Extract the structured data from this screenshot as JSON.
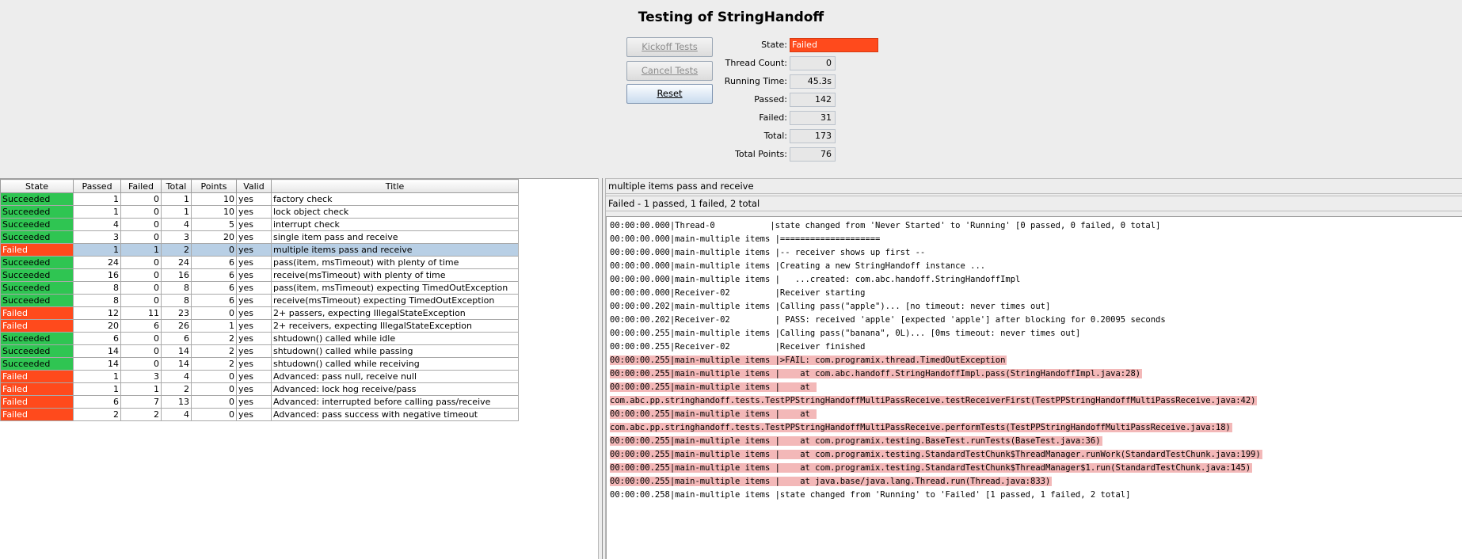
{
  "window_title": "Testing of StringHandoff",
  "buttons": {
    "kickoff": "Kickoff Tests",
    "cancel": "Cancel Tests",
    "reset": "Reset"
  },
  "stats": [
    {
      "label": "State:",
      "value": "Failed",
      "kind": "state"
    },
    {
      "label": "Thread Count:",
      "value": "0"
    },
    {
      "label": "Running Time:",
      "value": "45.3s"
    },
    {
      "label": "Passed:",
      "value": "142"
    },
    {
      "label": "Failed:",
      "value": "31"
    },
    {
      "label": "Total:",
      "value": "173"
    },
    {
      "label": "Total Points:",
      "value": "76"
    }
  ],
  "table": {
    "columns": [
      "State",
      "Passed",
      "Failed",
      "Total",
      "Points",
      "Valid",
      "Title"
    ],
    "rows": [
      [
        "Succeeded",
        "1",
        "0",
        "1",
        "10",
        "yes",
        "factory check"
      ],
      [
        "Succeeded",
        "1",
        "0",
        "1",
        "10",
        "yes",
        "lock object check"
      ],
      [
        "Succeeded",
        "4",
        "0",
        "4",
        "5",
        "yes",
        "interrupt check"
      ],
      [
        "Succeeded",
        "3",
        "0",
        "3",
        "20",
        "yes",
        "single item pass and receive"
      ],
      [
        "Failed",
        "1",
        "1",
        "2",
        "0",
        "yes",
        "multiple items pass and receive"
      ],
      [
        "Succeeded",
        "24",
        "0",
        "24",
        "6",
        "yes",
        "pass(item, msTimeout) with plenty of time"
      ],
      [
        "Succeeded",
        "16",
        "0",
        "16",
        "6",
        "yes",
        "receive(msTimeout) with plenty of time"
      ],
      [
        "Succeeded",
        "8",
        "0",
        "8",
        "6",
        "yes",
        "pass(item, msTimeout) expecting TimedOutException"
      ],
      [
        "Succeeded",
        "8",
        "0",
        "8",
        "6",
        "yes",
        "receive(msTimeout) expecting TimedOutException"
      ],
      [
        "Failed",
        "12",
        "11",
        "23",
        "0",
        "yes",
        "2+ passers, expecting IllegalStateException"
      ],
      [
        "Failed",
        "20",
        "6",
        "26",
        "1",
        "yes",
        "2+ receivers, expecting IllegalStateException"
      ],
      [
        "Succeeded",
        "6",
        "0",
        "6",
        "2",
        "yes",
        "shtudown() called while idle"
      ],
      [
        "Succeeded",
        "14",
        "0",
        "14",
        "2",
        "yes",
        "shtudown() called while passing"
      ],
      [
        "Succeeded",
        "14",
        "0",
        "14",
        "2",
        "yes",
        "shtudown() called while receiving"
      ],
      [
        "Failed",
        "1",
        "3",
        "4",
        "0",
        "yes",
        "Advanced: pass null, receive null"
      ],
      [
        "Failed",
        "1",
        "1",
        "2",
        "0",
        "yes",
        "Advanced: lock hog receive/pass"
      ],
      [
        "Failed",
        "6",
        "7",
        "13",
        "0",
        "yes",
        "Advanced: interrupted before calling pass/receive"
      ],
      [
        "Failed",
        "2",
        "2",
        "4",
        "0",
        "yes",
        "Advanced: pass success with negative timeout"
      ]
    ],
    "selected_row": 4
  },
  "detail": {
    "test_name": "multiple items pass and receive",
    "summary": "Failed - 1 passed, 1 failed, 2 total",
    "log": [
      {
        "text": "00:00:00.000|Thread-0           |state changed from 'Never Started' to 'Running' [0 passed, 0 failed, 0 total]",
        "err": false
      },
      {
        "text": "00:00:00.000|main-multiple items |====================",
        "err": false
      },
      {
        "text": "00:00:00.000|main-multiple items |-- receiver shows up first --",
        "err": false
      },
      {
        "text": "00:00:00.000|main-multiple items |Creating a new StringHandoff instance ...",
        "err": false
      },
      {
        "text": "00:00:00.000|main-multiple items |   ...created: com.abc.handoff.StringHandoffImpl",
        "err": false
      },
      {
        "text": "00:00:00.000|Receiver-02         |Receiver starting",
        "err": false
      },
      {
        "text": "00:00:00.202|main-multiple items |Calling pass(\"apple\")... [no timeout: never times out]",
        "err": false
      },
      {
        "text": "00:00:00.202|Receiver-02         | PASS: received 'apple' [expected 'apple'] after blocking for 0.20095 seconds",
        "err": false
      },
      {
        "text": "00:00:00.255|main-multiple items |Calling pass(\"banana\", 0L)... [0ms timeout: never times out]",
        "err": false
      },
      {
        "text": "00:00:00.255|Receiver-02         |Receiver finished",
        "err": false
      },
      {
        "text": "00:00:00.255|main-multiple items |>FAIL: com.programix.thread.TimedOutException",
        "err": true
      },
      {
        "text": "00:00:00.255|main-multiple items |    at com.abc.handoff.StringHandoffImpl.pass(StringHandoffImpl.java:28)",
        "err": true
      },
      {
        "text": "00:00:00.255|main-multiple items |    at ",
        "err": true
      },
      {
        "text": "com.abc.pp.stringhandoff.tests.TestPPStringHandoffMultiPassReceive.testReceiverFirst(TestPPStringHandoffMultiPassReceive.java:42)",
        "err": true
      },
      {
        "text": "00:00:00.255|main-multiple items |    at ",
        "err": true
      },
      {
        "text": "com.abc.pp.stringhandoff.tests.TestPPStringHandoffMultiPassReceive.performTests(TestPPStringHandoffMultiPassReceive.java:18)",
        "err": true
      },
      {
        "text": "00:00:00.255|main-multiple items |    at com.programix.testing.BaseTest.runTests(BaseTest.java:36)",
        "err": true
      },
      {
        "text": "00:00:00.255|main-multiple items |    at com.programix.testing.StandardTestChunk$ThreadManager.runWork(StandardTestChunk.java:199)",
        "err": true
      },
      {
        "text": "00:00:00.255|main-multiple items |    at com.programix.testing.StandardTestChunk$ThreadManager$1.run(StandardTestChunk.java:145)",
        "err": true
      },
      {
        "text": "00:00:00.255|main-multiple items |    at java.base/java.lang.Thread.run(Thread.java:833)",
        "err": true
      },
      {
        "text": "00:00:00.258|main-multiple items |state changed from 'Running' to 'Failed' [1 passed, 1 failed, 2 total]",
        "err": false
      }
    ]
  },
  "colors": {
    "succeeded": "#2fc552",
    "failed": "#ff4a1c",
    "selected": "#b8cfe5",
    "error_highlight": "#f3b8b8"
  }
}
